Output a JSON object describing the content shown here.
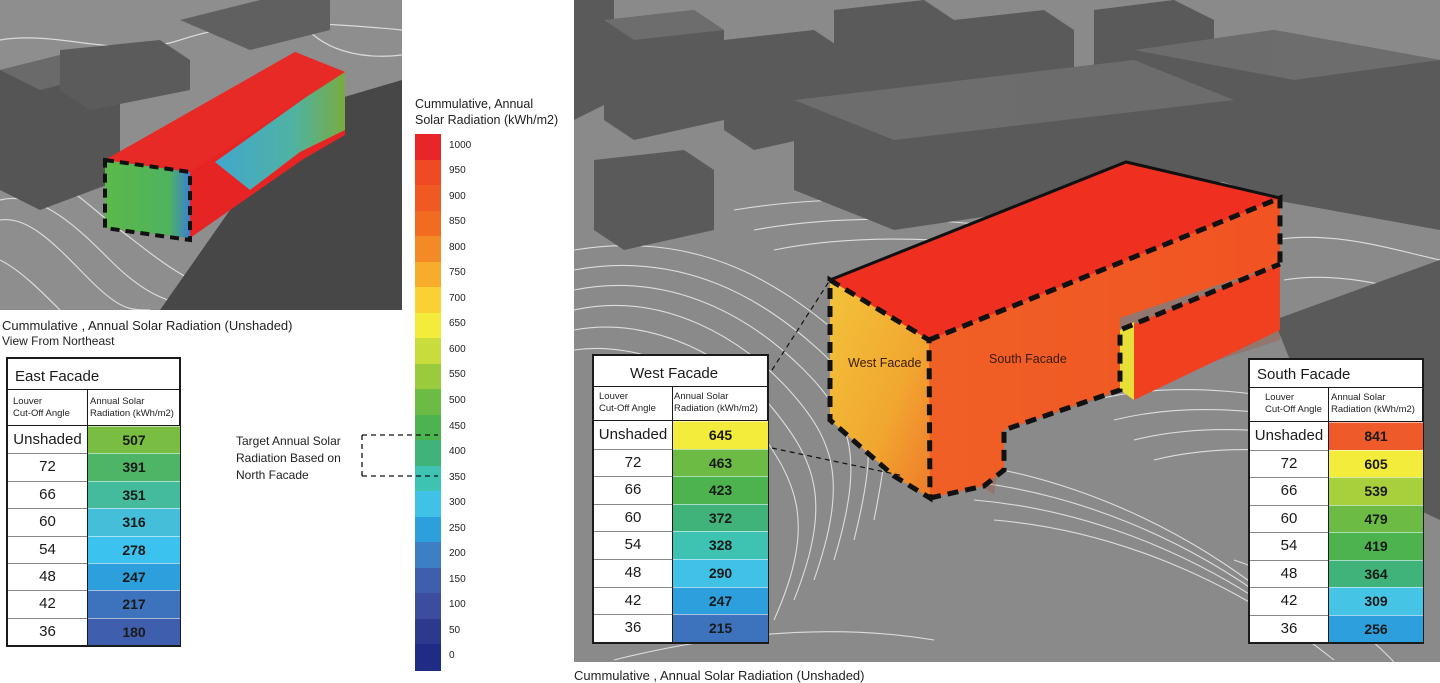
{
  "legend": {
    "title_line1": "Cummulative, Annual",
    "title_line2": "Solar Radiation (kWh/m2)",
    "ticks": [
      "1000",
      "950",
      "900",
      "850",
      "800",
      "750",
      "700",
      "650",
      "600",
      "550",
      "500",
      "450",
      "400",
      "350",
      "300",
      "250",
      "200",
      "150",
      "100",
      "50",
      "0"
    ],
    "colors": [
      "#e8262a",
      "#ef4a24",
      "#f05a22",
      "#f16b21",
      "#f48a25",
      "#f7ac2c",
      "#fbd035",
      "#f4ec3a",
      "#c8dc3b",
      "#9acb3c",
      "#6cbb44",
      "#4cb34e",
      "#3fb37a",
      "#3ec2b1",
      "#3fc2e6",
      "#2d9fdc",
      "#3c7fc4",
      "#3f5fae",
      "#3c4c9e",
      "#2c3a8e",
      "#1e2c86"
    ]
  },
  "target_annotation": {
    "line1": "Target Annual Solar",
    "line2": "Radiation Based on",
    "line3": "North Facade"
  },
  "top_left_caption": {
    "line1": "Cummulative , Annual Solar Radiation (Unshaded)",
    "line2": "View From Northeast"
  },
  "bottom_caption": "Cummulative , Annual Solar Radiation (Unshaded)",
  "model_labels": {
    "west": "West Facade",
    "south": "South Facade"
  },
  "tables": {
    "east": {
      "title": "East Facade",
      "hdr_angle_1": "Louver",
      "hdr_angle_2": "Cut-Off Angle",
      "hdr_rad_1": "Annual Solar",
      "hdr_rad_2": "Radiation (kWh/m2)",
      "rows": [
        {
          "angle": "Unshaded",
          "value": "507",
          "color": "#79bd43"
        },
        {
          "angle": "72",
          "value": "391",
          "color": "#4eb567"
        },
        {
          "angle": "66",
          "value": "351",
          "color": "#44bb9b"
        },
        {
          "angle": "60",
          "value": "316",
          "color": "#45bfd9"
        },
        {
          "angle": "54",
          "value": "278",
          "color": "#3cc2ee"
        },
        {
          "angle": "48",
          "value": "247",
          "color": "#2d9fdc"
        },
        {
          "angle": "42",
          "value": "217",
          "color": "#3d73bd"
        },
        {
          "angle": "36",
          "value": "180",
          "color": "#3f5fae"
        }
      ]
    },
    "west": {
      "title": "West Facade",
      "hdr_angle_1": "Louver",
      "hdr_angle_2": "Cut-Off Angle",
      "hdr_rad_1": "Annual Solar",
      "hdr_rad_2": "Radiation (kWh/m2)",
      "rows": [
        {
          "angle": "Unshaded",
          "value": "645",
          "color": "#f4ec3a"
        },
        {
          "angle": "72",
          "value": "463",
          "color": "#6cbb44"
        },
        {
          "angle": "66",
          "value": "423",
          "color": "#4cb34e"
        },
        {
          "angle": "60",
          "value": "372",
          "color": "#3fb37a"
        },
        {
          "angle": "54",
          "value": "328",
          "color": "#3ec2b1"
        },
        {
          "angle": "48",
          "value": "290",
          "color": "#3fc2e6"
        },
        {
          "angle": "42",
          "value": "247",
          "color": "#2d9fdc"
        },
        {
          "angle": "36",
          "value": "215",
          "color": "#3d73bd"
        }
      ]
    },
    "south": {
      "title": "South Facade",
      "hdr_angle_1": "Louver",
      "hdr_angle_2": "Cut-Off Angle",
      "hdr_rad_1": "Annual Solar",
      "hdr_rad_2": "Radiation (kWh/m2)",
      "rows": [
        {
          "angle": "Unshaded",
          "value": "841",
          "color": "#ef5a2a"
        },
        {
          "angle": "72",
          "value": "605",
          "color": "#f4ec3a"
        },
        {
          "angle": "66",
          "value": "539",
          "color": "#a8cf3c"
        },
        {
          "angle": "60",
          "value": "479",
          "color": "#6cbb44"
        },
        {
          "angle": "54",
          "value": "419",
          "color": "#4cb34e"
        },
        {
          "angle": "48",
          "value": "364",
          "color": "#3fb37a"
        },
        {
          "angle": "42",
          "value": "309",
          "color": "#45c4e6"
        },
        {
          "angle": "36",
          "value": "256",
          "color": "#2d9fdc"
        }
      ]
    }
  }
}
